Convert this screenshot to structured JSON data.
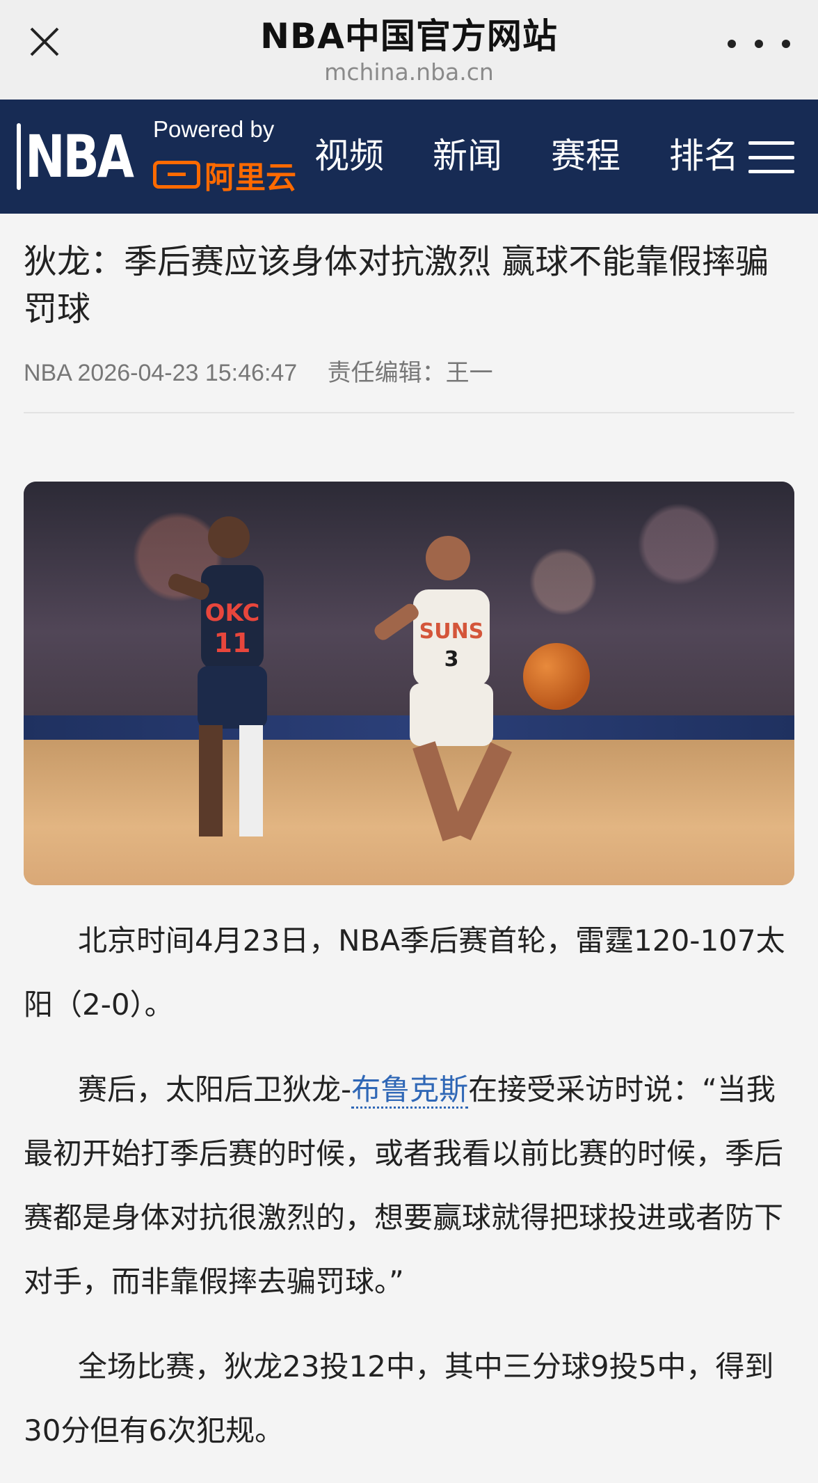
{
  "browser": {
    "title": "NBA中国官方网站",
    "url": "mchina.nba.cn"
  },
  "nav": {
    "logo_text": "NBA",
    "powered_by": "Powered by",
    "partner": "阿里云",
    "items": [
      {
        "label": "视频"
      },
      {
        "label": "新闻"
      },
      {
        "label": "赛程"
      },
      {
        "label": "排名"
      }
    ]
  },
  "article": {
    "headline": "狄龙：季后赛应该身体对抗激烈 赢球不能靠假摔骗罚球",
    "source": "NBA",
    "datetime": "2026-04-23 15:46:47",
    "editor": "责任编辑：王一",
    "paragraphs": {
      "p1": "北京时间4月23日，NBA季后赛首轮，雷霆120-107太阳（2-0）。",
      "p2_before": "赛后，太阳后卫狄龙-",
      "p2_link": "布鲁克斯",
      "p2_after": "在接受采访时说：“当我最初开始打季后赛的时候，或者我看以前比赛的时候，季后赛都是身体对抗很激烈的，想要赢球就得把球投进或者防下对手，而非靠假摔去骗罚球。”",
      "p3": "全场比赛，狄龙23投12中，其中三分球9投5中，得到30分但有6次犯规。"
    },
    "photo": {
      "okc_jersey": "OKC",
      "okc_number": "11",
      "phx_jersey": "SUNS",
      "phx_number": "3"
    }
  },
  "colors": {
    "navbar": "#172b54",
    "accent": "#ff6a00",
    "link": "#2f67b6"
  }
}
